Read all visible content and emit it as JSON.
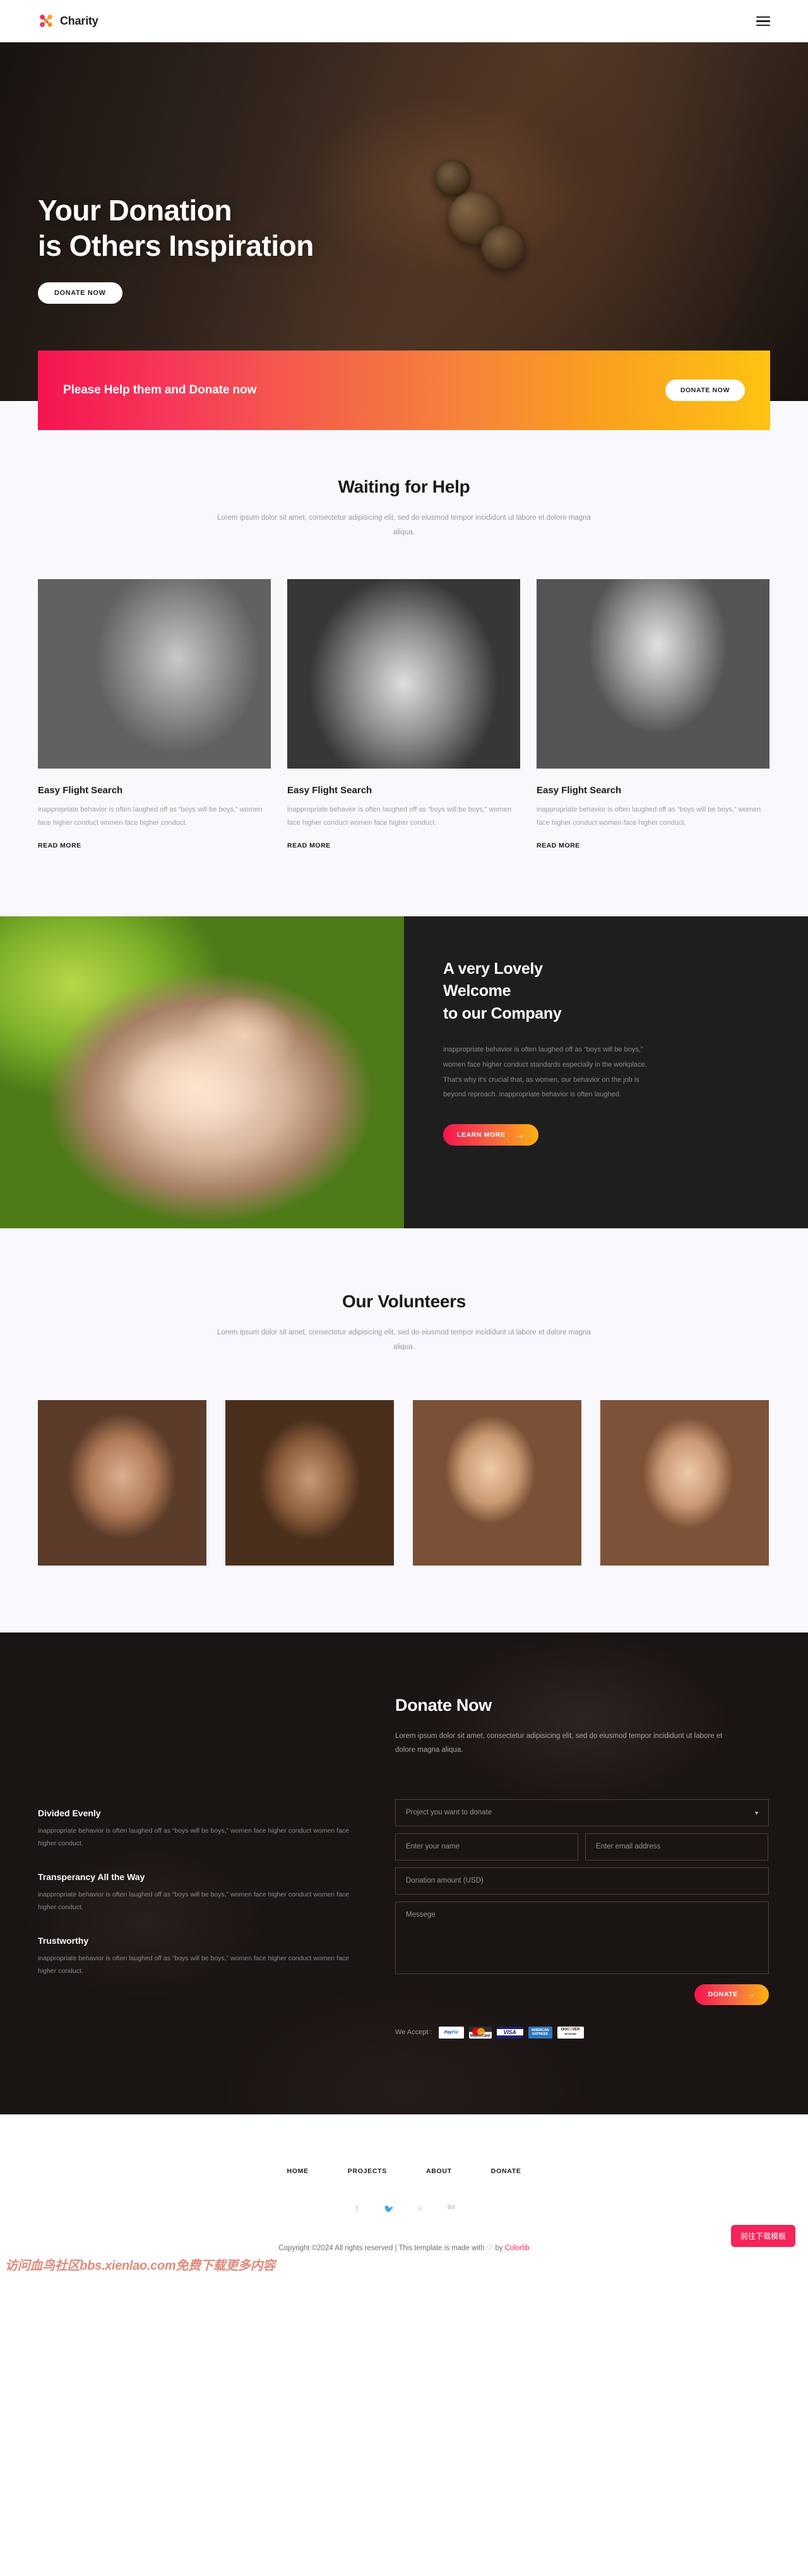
{
  "header": {
    "brand": "Charity",
    "menu_icon": "hamburger-icon"
  },
  "hero": {
    "title_line1": "Your Donation",
    "title_line2": "is Others Inspiration",
    "cta_label": "DONATE NOW"
  },
  "cta_banner": {
    "text": "Please Help them and Donate now",
    "button_label": "DONATE NOW",
    "gradient_from": "#F5144F",
    "gradient_to": "#FDC312"
  },
  "waiting": {
    "title": "Waiting for Help",
    "subtitle": "Lorem ipsum dolor sit amet, consectetur adipisicing elit, sed do eiusmod tempor incididunt ut labore et dolore magna aliqua.",
    "cards": [
      {
        "image": "girl-with-child-photo",
        "title": "Easy Flight Search",
        "text": "inappropriate behavior is often laughed off as “boys will be boys,” women face higher conduct women face higher conduct.",
        "link": "READ MORE"
      },
      {
        "image": "worn-sandals-photo",
        "title": "Easy Flight Search",
        "text": "inappropriate behavior is often laughed off as “boys will be boys,” women face higher conduct women face higher conduct.",
        "link": "READ MORE"
      },
      {
        "image": "elderly-man-photo",
        "title": "Easy Flight Search",
        "text": "inappropriate behavior is often laughed off as “boys will be boys,” women face higher conduct women face higher conduct.",
        "link": "READ MORE"
      }
    ]
  },
  "welcome": {
    "image": "holding-hands-photo",
    "title_line1": "A very Lovely",
    "title_line2": "Welcome",
    "title_line3": "to our Company",
    "body": "inappropriate behavior is often laughed off as “boys will be boys,” women face higher conduct standards especially in the workplace. That’s why it’s crucial that, as women, our behavior on the job is beyond reproach. inappropriate behavior is often laughed.",
    "button_label": "LEARN MORE",
    "button_icon": "arrow-right-icon"
  },
  "volunteers": {
    "title": "Our Volunteers",
    "subtitle": "Lorem ipsum dolor sit amet, consectetur adipisicing elit, sed do eiusmod tempor incididunt ut labore et dolore magna aliqua.",
    "people": [
      "volunteer-photo-1",
      "volunteer-photo-2",
      "volunteer-photo-3",
      "volunteer-photo-4"
    ]
  },
  "donate": {
    "title": "Donate Now",
    "subtitle": "Lorem ipsum dolor sit amet, consectetur adipisicing elit, sed do eiusmod tempor incididunt ut labore et dolore magna aliqua.",
    "features": [
      {
        "title": "Divided Evenly",
        "text": "inappropriate behavior is often laughed off as “boys will be boys,” women face higher conduct women face higher conduct."
      },
      {
        "title": "Transperancy All the Way",
        "text": "inappropriate behavior is often laughed off as “boys will be boys,” women face higher conduct women face higher conduct."
      },
      {
        "title": "Trustworthy",
        "text": "inappropriate behavior is often laughed off as “boys will be boys,” women face higher conduct women face higher conduct."
      }
    ],
    "form": {
      "project_placeholder": "Project you want to donate",
      "project_caret": "chevron-down-icon",
      "name_placeholder": "Enter your name",
      "email_placeholder": "Enter email address",
      "amount_placeholder": "Donation amount (USD)",
      "message_placeholder": "Messege",
      "submit_label": "DONATE",
      "submit_icon": "arrow-right-icon"
    },
    "accept_label": "We Accept :",
    "payments": [
      {
        "name": "paypal",
        "label": "Pay",
        "label2": "Pal"
      },
      {
        "name": "mastercard",
        "label": "MasterCard"
      },
      {
        "name": "visa",
        "label": "VISA"
      },
      {
        "name": "american-express",
        "label": "AMERICAN",
        "label2": "EXPRESS"
      },
      {
        "name": "discover",
        "label": "DISC",
        "label2": "VER",
        "sub": "NETWORK"
      }
    ]
  },
  "footer": {
    "nav": [
      "HOME",
      "PROJECTS",
      "ABOUT",
      "DONATE"
    ],
    "socials": [
      "facebook-icon",
      "twitter-icon",
      "dribbble-icon",
      "behance-icon"
    ],
    "social_glyphs": [
      "f",
      "ᵛ",
      "⊛",
      "Bē"
    ],
    "copyright_prefix": "Copyright ©2024 All rights reserved | This template is made with ",
    "copyright_heart": "♡",
    "copyright_by": " by ",
    "copyright_brand": "Colorlib"
  },
  "overlays": {
    "watermark": "访问血鸟社区bbs.xienlao.com免费下载更多内容",
    "float_button": "前往下载模板"
  }
}
